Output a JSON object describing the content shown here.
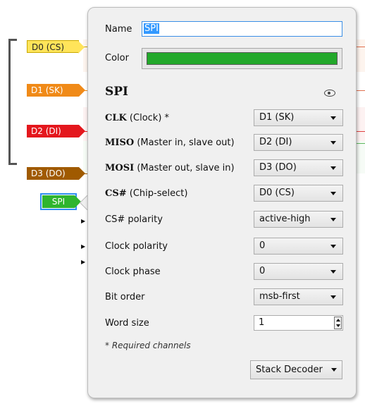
{
  "channels": [
    {
      "label": "D0 (CS)"
    },
    {
      "label": "D1 (SK)"
    },
    {
      "label": "D2 (DI)"
    },
    {
      "label": "D3 (DO)"
    }
  ],
  "decoder_tag": "SPI",
  "popup": {
    "name_label": "Name",
    "name_value": "SPI",
    "color_label": "Color",
    "color_value": "#22a82a",
    "section_title": "SPI",
    "visibility_icon": "eye-icon",
    "rows": [
      {
        "name_bold": "CLK",
        "name_rest": " (Clock) *",
        "value": "D1 (SK)"
      },
      {
        "name_bold": "MISO",
        "name_rest": " (Master in, slave out)",
        "value": "D2 (DI)"
      },
      {
        "name_bold": "MOSI",
        "name_rest": " (Master out, slave in)",
        "value": "D3 (DO)"
      },
      {
        "name_bold": "CS#",
        "name_rest": " (Chip-select)",
        "value": "D0 (CS)"
      },
      {
        "name_bold": "",
        "name_rest": "CS# polarity",
        "value": "active-high"
      },
      {
        "name_bold": "",
        "name_rest": "Clock polarity",
        "value": "0"
      },
      {
        "name_bold": "",
        "name_rest": "Clock phase",
        "value": "0"
      },
      {
        "name_bold": "",
        "name_rest": "Bit order",
        "value": "msb-first"
      }
    ],
    "word_size_label": "Word size",
    "word_size_value": "1",
    "required_note": "* Required channels",
    "stack_button": "Stack Decoder"
  }
}
